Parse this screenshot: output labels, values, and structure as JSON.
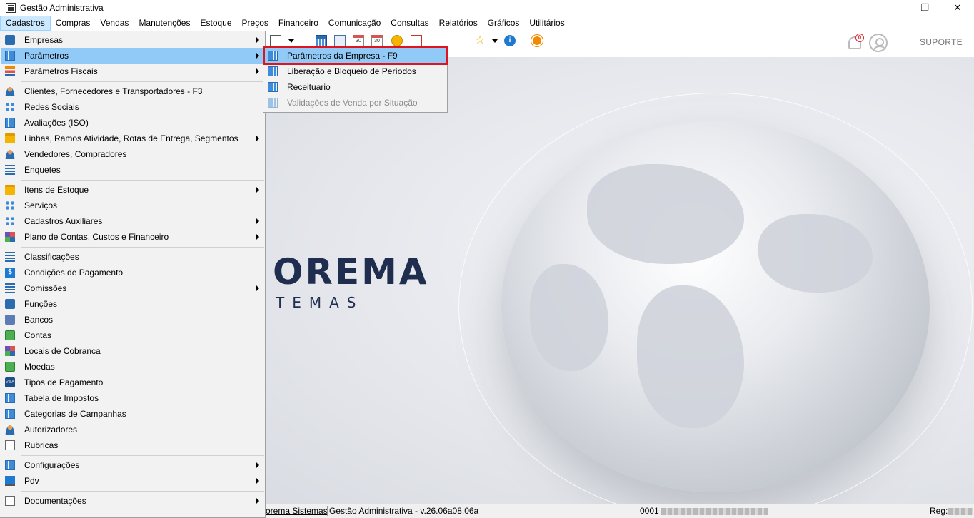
{
  "window": {
    "title": "Gestão Administrativa",
    "controls": {
      "minimize": "—",
      "restore": "❐",
      "close": "✕"
    }
  },
  "menubar": {
    "items": [
      "Cadastros",
      "Compras",
      "Vendas",
      "Manutenções",
      "Estoque",
      "Preços",
      "Financeiro",
      "Comunicação",
      "Consultas",
      "Relatórios",
      "Gráficos",
      "Utilitários"
    ],
    "active": "Cadastros"
  },
  "toolbar": {
    "notification_count": "0",
    "support_label": "SUPORTE",
    "icons": [
      "report-icon",
      "grid-icon",
      "calculator-icon",
      "calendar-icon",
      "calendar-settings-icon",
      "lock-icon",
      "chart-report-icon",
      "star-icon",
      "info-icon",
      "power-icon"
    ]
  },
  "cadastros_menu": {
    "items": [
      {
        "label": "Empresas",
        "icon": "company-icon",
        "submenu": true
      },
      {
        "label": "Parâmetros",
        "icon": "parameters-icon",
        "submenu": true,
        "highlighted": true
      },
      {
        "label": "Parâmetros Fiscais",
        "icon": "fiscal-icon",
        "submenu": true
      },
      {
        "label": "Clientes, Fornecedores e Transportadores - F3",
        "icon": "people-icon",
        "submenu": false
      },
      {
        "label": "Redes Sociais",
        "icon": "network-icon",
        "submenu": false
      },
      {
        "label": "Avaliações (ISO)",
        "icon": "grid-icon",
        "submenu": false
      },
      {
        "label": "Linhas, Ramos Atividade, Rotas de Entrega, Segmentos",
        "icon": "tree-icon",
        "submenu": true
      },
      {
        "label": "Vendedores, Compradores",
        "icon": "person-icon",
        "submenu": false
      },
      {
        "label": "Enquetes",
        "icon": "list-icon",
        "submenu": false
      },
      {
        "label": "Itens de Estoque",
        "icon": "stock-icon",
        "submenu": true
      },
      {
        "label": "Serviços",
        "icon": "services-icon",
        "submenu": false
      },
      {
        "label": "Cadastros Auxiliares",
        "icon": "network-icon",
        "submenu": true
      },
      {
        "label": "Plano de Contas, Custos e Financeiro",
        "icon": "accounts-icon",
        "submenu": true
      },
      {
        "label": "Classificações",
        "icon": "list-icon",
        "submenu": false
      },
      {
        "label": "Condições de Pagamento",
        "icon": "dollar-icon",
        "submenu": false
      },
      {
        "label": "Comissões",
        "icon": "list-icon",
        "submenu": true
      },
      {
        "label": "Funções",
        "icon": "book-icon",
        "submenu": false
      },
      {
        "label": "Bancos",
        "icon": "bank-icon",
        "submenu": false
      },
      {
        "label": "Contas",
        "icon": "money-icon",
        "submenu": false
      },
      {
        "label": "Locais de Cobranca",
        "icon": "tiles-icon",
        "submenu": false
      },
      {
        "label": "Moedas",
        "icon": "money-icon",
        "submenu": false
      },
      {
        "label": "Tipos de Pagamento",
        "icon": "card-icon",
        "submenu": false
      },
      {
        "label": "Tabela de Impostos",
        "icon": "grid-icon",
        "submenu": false
      },
      {
        "label": "Categorias de Campanhas",
        "icon": "grid-icon",
        "submenu": false
      },
      {
        "label": "Autorizadores",
        "icon": "person-icon",
        "submenu": false
      },
      {
        "label": "Rubricas",
        "icon": "doc-check-icon",
        "submenu": false
      },
      {
        "label": "Configurações",
        "icon": "grid-icon",
        "submenu": true
      },
      {
        "label": "Pdv",
        "icon": "pdv-icon",
        "submenu": true
      },
      {
        "label": "Documentações",
        "icon": "doc-icon",
        "submenu": true
      }
    ]
  },
  "parametros_submenu": {
    "items": [
      {
        "label": "Parâmetros da Empresa - F9",
        "icon": "parameters-icon",
        "highlighted": true,
        "enabled": true
      },
      {
        "label": "Liberação e Bloqueio de Períodos",
        "icon": "grid-icon",
        "enabled": true
      },
      {
        "label": "Receituario",
        "icon": "grid-icon",
        "enabled": true
      },
      {
        "label": "Validações de Venda por Situação",
        "icon": "grid-icon",
        "enabled": false
      }
    ]
  },
  "background": {
    "logo_text": "OREMA",
    "logo_subtext": "TEMAS"
  },
  "statusbar": {
    "brand": "orema Sistemas",
    "version": "Gestão Administrativa - v.26.06a08.06a",
    "code_prefix": "0001",
    "reg_label": "Reg:"
  }
}
